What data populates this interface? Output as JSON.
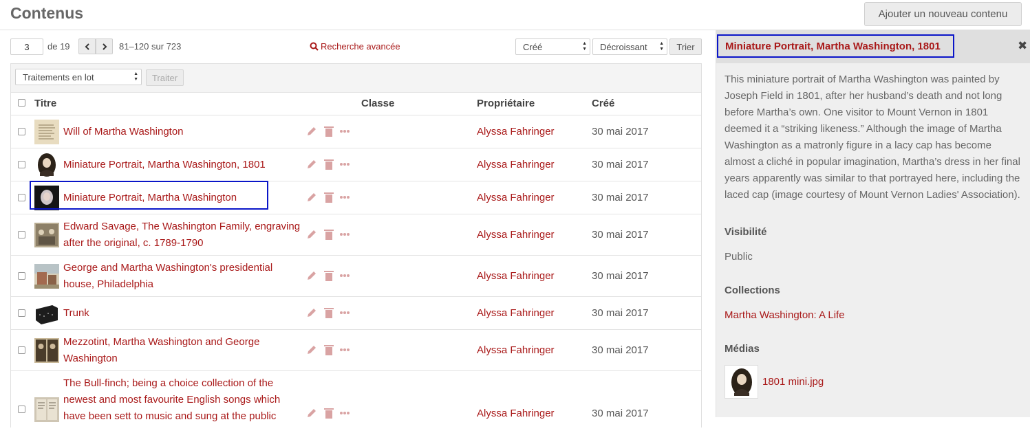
{
  "header": {
    "title": "Contenus",
    "add_button": "Ajouter un nouveau contenu"
  },
  "pagination": {
    "current_page": "3",
    "of_text": "de 19",
    "range_text": "81–120 sur 723"
  },
  "advanced_search": "Recherche avancée",
  "sort": {
    "by": "Créé",
    "order": "Décroissant",
    "button": "Trier"
  },
  "batch": {
    "select": "Traitements en lot",
    "button": "Traiter"
  },
  "columns": {
    "title": "Titre",
    "class": "Classe",
    "owner": "Propriétaire",
    "created": "Créé"
  },
  "rows": [
    {
      "title": "Will of Martha Washington",
      "owner": "Alyssa Fahringer",
      "created": "30 mai 2017"
    },
    {
      "title": "Miniature Portrait, Martha Washington, 1801",
      "owner": "Alyssa Fahringer",
      "created": "30 mai 2017"
    },
    {
      "title": "Miniature Portrait, Martha Washington",
      "owner": "Alyssa Fahringer",
      "created": "30 mai 2017"
    },
    {
      "title": "Edward Savage, The Washington Family, engraving after the original, c. 1789-1790",
      "owner": "Alyssa Fahringer",
      "created": "30 mai 2017"
    },
    {
      "title": "George and Martha Washington's presidential house, Philadelphia",
      "owner": "Alyssa Fahringer",
      "created": "30 mai 2017"
    },
    {
      "title": "Trunk",
      "owner": "Alyssa Fahringer",
      "created": "30 mai 2017"
    },
    {
      "title": "Mezzotint, Martha Washington and George Washington",
      "owner": "Alyssa Fahringer",
      "created": "30 mai 2017"
    },
    {
      "title": "The Bull-finch; being a choice collection of the newest and most favourite English songs which have been sett to music and sung at the public",
      "owner": "Alyssa Fahringer",
      "created": "30 mai 2017"
    }
  ],
  "sidebar": {
    "title": "Miniature Portrait, Martha Washington, 1801",
    "description": "This miniature portrait of Martha Washington was painted by Joseph Field in 1801, after her husband’s death and not long before Martha’s own. One visitor to Mount Vernon in 1801 deemed it a “striking likeness.” Although the image of Martha Washington as a matronly figure in a lacy cap has become almost a cliché in popular imagination, Martha’s dress in her final years apparently was similar to that portrayed here, including the laced cap (image courtesy of Mount Vernon Ladies' Association).",
    "visibility_label": "Visibilité",
    "visibility_value": "Public",
    "collections_label": "Collections",
    "collection_link": "Martha Washington: A Life",
    "media_label": "Médias",
    "media_file": "1801 mini.jpg"
  },
  "colors": {
    "link": "#a91919",
    "highlight": "#0a15c8"
  },
  "icons": [
    "search-icon",
    "chevron-left-icon",
    "chevron-right-icon",
    "pencil-icon",
    "trash-icon",
    "ellipsis-icon",
    "close-icon"
  ]
}
